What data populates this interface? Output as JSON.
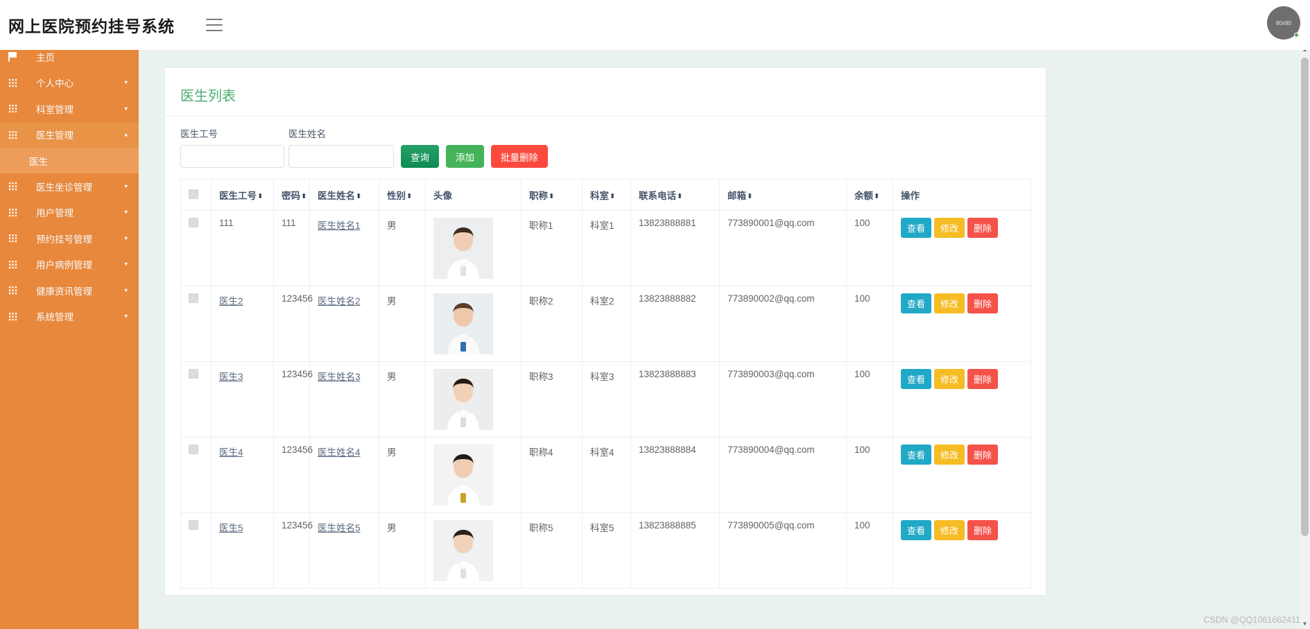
{
  "app": {
    "title": "网上医院预约挂号系统",
    "menu_toggle": "hamburger-menu",
    "avatar_label": "80x80"
  },
  "sidebar": {
    "items": [
      {
        "label": "主页",
        "icon": "flag-icon",
        "has_caret": false,
        "active": false
      },
      {
        "label": "个人中心",
        "icon": "grid-icon",
        "has_caret": true,
        "active": false
      },
      {
        "label": "科室管理",
        "icon": "grid-icon",
        "has_caret": true,
        "active": false
      },
      {
        "label": "医生管理",
        "icon": "grid-icon",
        "has_caret": true,
        "active": true
      },
      {
        "label": "医生坐诊管理",
        "icon": "grid-icon",
        "has_caret": true,
        "active": false
      },
      {
        "label": "用户管理",
        "icon": "grid-icon",
        "has_caret": true,
        "active": false
      },
      {
        "label": "预约挂号管理",
        "icon": "grid-icon",
        "has_caret": true,
        "active": false
      },
      {
        "label": "用户病例管理",
        "icon": "grid-icon",
        "has_caret": true,
        "active": false
      },
      {
        "label": "健康资讯管理",
        "icon": "grid-icon",
        "has_caret": true,
        "active": false
      },
      {
        "label": "系统管理",
        "icon": "grid-icon",
        "has_caret": true,
        "active": false
      }
    ],
    "submenu": [
      {
        "label": "医生",
        "parent": "医生管理"
      }
    ],
    "caret_down": "▾",
    "caret_up": "▴"
  },
  "page": {
    "title": "医生列表"
  },
  "search": {
    "fields": [
      {
        "label": "医生工号",
        "value": "",
        "placeholder": ""
      },
      {
        "label": "医生姓名",
        "value": "",
        "placeholder": ""
      }
    ],
    "buttons": {
      "query": "查询",
      "add": "添加",
      "batch_delete": "批量删除"
    }
  },
  "table": {
    "headers": [
      {
        "label": "",
        "sortable": false,
        "type": "checkbox"
      },
      {
        "label": "医生工号",
        "sortable": true
      },
      {
        "label": "密码",
        "sortable": true
      },
      {
        "label": "医生姓名",
        "sortable": true
      },
      {
        "label": "性别",
        "sortable": true
      },
      {
        "label": "头像",
        "sortable": false
      },
      {
        "label": "职称",
        "sortable": true
      },
      {
        "label": "科室",
        "sortable": true
      },
      {
        "label": "联系电话",
        "sortable": true
      },
      {
        "label": "邮箱",
        "sortable": true
      },
      {
        "label": "余额",
        "sortable": true
      },
      {
        "label": "操作",
        "sortable": false
      }
    ],
    "sort_glyph": "⬍",
    "rows": [
      {
        "doctor_no": "111",
        "password": "111",
        "doctor_name": "医生姓名1",
        "gender": "男",
        "avatar": "doctor-photo-1",
        "title": "职称1",
        "department": "科室1",
        "phone": "13823888881",
        "email": "773890001@qq.com",
        "balance": "100",
        "no_is_link": false
      },
      {
        "doctor_no": "医生2",
        "password": "123456",
        "doctor_name": "医生姓名2",
        "gender": "男",
        "avatar": "doctor-photo-2",
        "title": "职称2",
        "department": "科室2",
        "phone": "13823888882",
        "email": "773890002@qq.com",
        "balance": "100",
        "no_is_link": true
      },
      {
        "doctor_no": "医生3",
        "password": "123456",
        "doctor_name": "医生姓名3",
        "gender": "男",
        "avatar": "doctor-photo-3",
        "title": "职称3",
        "department": "科室3",
        "phone": "13823888883",
        "email": "773890003@qq.com",
        "balance": "100",
        "no_is_link": true
      },
      {
        "doctor_no": "医生4",
        "password": "123456",
        "doctor_name": "医生姓名4",
        "gender": "男",
        "avatar": "doctor-photo-4",
        "title": "职称4",
        "department": "科室4",
        "phone": "13823888884",
        "email": "773890004@qq.com",
        "balance": "100",
        "no_is_link": true
      },
      {
        "doctor_no": "医生5",
        "password": "123456",
        "doctor_name": "医生姓名5",
        "gender": "男",
        "avatar": "doctor-photo-5",
        "title": "职称5",
        "department": "科室5",
        "phone": "13823888885",
        "email": "773890005@qq.com",
        "balance": "100",
        "no_is_link": true
      }
    ],
    "row_actions": {
      "view": "查看",
      "edit": "修改",
      "delete": "删除"
    }
  },
  "colors": {
    "sidebar": "#e8883c",
    "sidebar_active": "#e99347",
    "submenu": "#ed9d59",
    "content_bg": "#e9f2ec",
    "title_green": "#4aae71",
    "btn_query": "#0f8a52",
    "btn_add": "#45b35a",
    "btn_delete": "#fb4a3d",
    "op_view": "#20a8c6",
    "op_edit": "#f5bc24",
    "op_delete": "#f5524a"
  },
  "watermark": "CSDN @QQ1061662411"
}
